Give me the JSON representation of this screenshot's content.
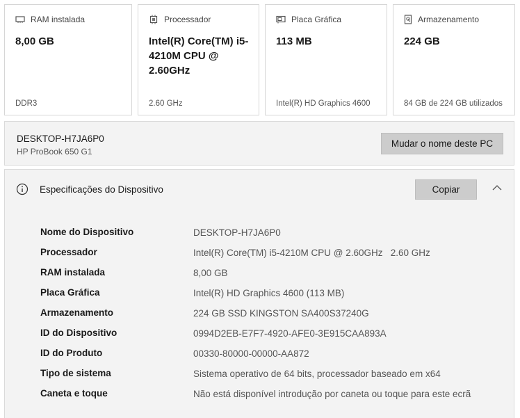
{
  "cards": [
    {
      "icon": "ram-icon",
      "title": "RAM instalada",
      "value": "8,00 GB",
      "sub": "DDR3"
    },
    {
      "icon": "processor-icon",
      "title": "Processador",
      "value": "Intel(R) Core(TM) i5-4210M CPU @ 2.60GHz",
      "sub": "2.60 GHz"
    },
    {
      "icon": "graphics-card-icon",
      "title": "Placa Gráfica",
      "value": "113 MB",
      "sub": "Intel(R) HD Graphics 4600"
    },
    {
      "icon": "storage-icon",
      "title": "Armazenamento",
      "value": "224 GB",
      "sub": "84 GB de 224 GB utilizados"
    }
  ],
  "pc": {
    "name": "DESKTOP-H7JA6P0",
    "model": "HP ProBook 650 G1",
    "rename_label": "Mudar o nome deste PC"
  },
  "specs": {
    "title": "Especificações do Dispositivo",
    "copy_label": "Copiar",
    "rows": [
      {
        "key": "Nome do Dispositivo",
        "value": "DESKTOP-H7JA6P0"
      },
      {
        "key": "Processador",
        "value": "Intel(R) Core(TM) i5-4210M CPU @ 2.60GHz   2.60 GHz"
      },
      {
        "key": "RAM instalada",
        "value": "8,00 GB"
      },
      {
        "key": "Placa Gráfica",
        "value": "Intel(R) HD Graphics 4600 (113 MB)"
      },
      {
        "key": "Armazenamento",
        "value": "224 GB SSD KINGSTON SA400S37240G"
      },
      {
        "key": "ID do Dispositivo",
        "value": "0994D2EB-E7F7-4920-AFE0-3E915CAA893A"
      },
      {
        "key": "ID do Produto",
        "value": "00330-80000-00000-AA872"
      },
      {
        "key": "Tipo de sistema",
        "value": "Sistema operativo de 64 bits, processador baseado em x64"
      },
      {
        "key": "Caneta e toque",
        "value": "Não está disponível introdução por caneta ou toque para este ecrã"
      }
    ]
  }
}
